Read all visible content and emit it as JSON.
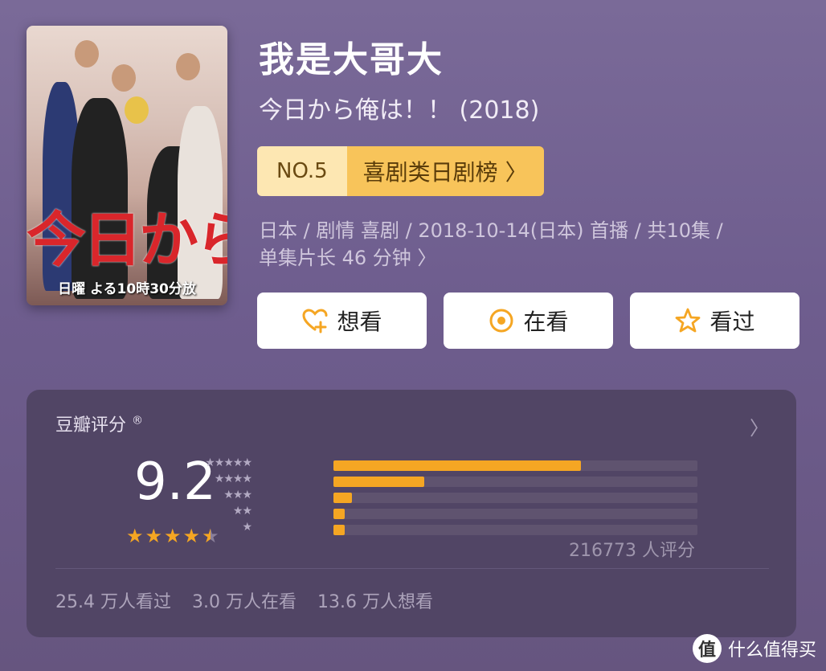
{
  "poster": {
    "title_overlay": "今日から俺",
    "bottom_text": "日曜 よる10時30分放"
  },
  "header": {
    "title": "我是大哥大",
    "subtitle": "今日から俺は！！ (2018)"
  },
  "rank": {
    "number": "NO.5",
    "board": "喜剧类日剧榜 〉"
  },
  "meta": {
    "line1": "日本 / 剧情 喜剧 / 2018-10-14(日本) 首播 / 共10集 /",
    "line2": "单集片长 46 分钟 〉"
  },
  "actions": {
    "want": "想看",
    "watching": "在看",
    "watched": "看过"
  },
  "rating": {
    "title": "豆瓣评分",
    "registered_mark": "®",
    "arrow": "〉",
    "score": "9.2",
    "stars_value": 4.5,
    "distribution_pct": [
      68,
      25,
      5,
      3,
      3
    ],
    "star_labels": [
      "★★★★★",
      "★★★★",
      "★★★",
      "★★",
      "★"
    ],
    "count": "216773 人评分",
    "stats": {
      "watched": "25.4 万人看过",
      "watching": "3.0 万人在看",
      "want": "13.6 万人想看"
    }
  },
  "watermark": {
    "icon_text": "值",
    "label": "什么值得买"
  },
  "colors": {
    "accent": "#f5a623",
    "card": "#514565"
  }
}
